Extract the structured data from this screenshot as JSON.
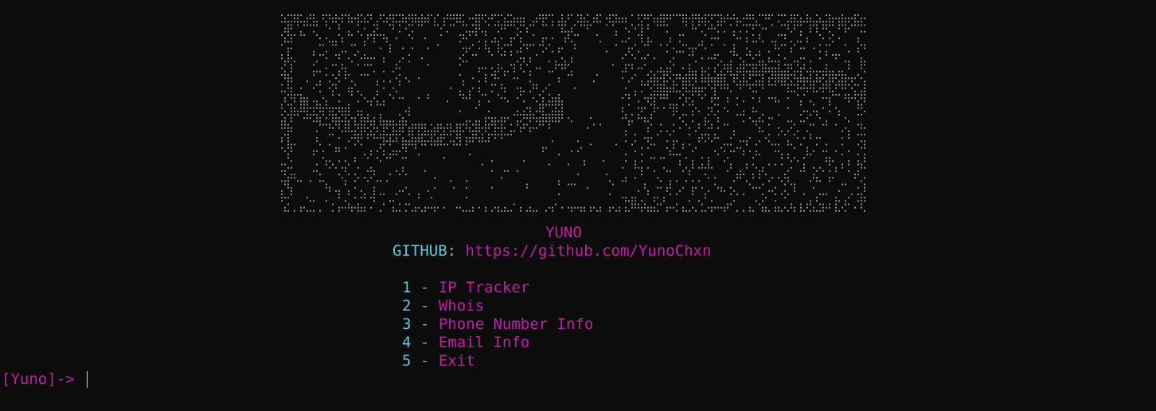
{
  "banner": {
    "name": "ascii-art-banner"
  },
  "title": "YUNO",
  "github": {
    "label": "GITHUB:",
    "url": "https://github.com/YunoChxn"
  },
  "menu": [
    {
      "number": "1",
      "separator": "-",
      "label": "IP Tracker"
    },
    {
      "number": "2",
      "separator": "-",
      "label": "Whois"
    },
    {
      "number": "3",
      "separator": "-",
      "label": "Phone Number Info"
    },
    {
      "number": "4",
      "separator": "-",
      "label": "Email Info"
    },
    {
      "number": "5",
      "separator": "-",
      "label": "Exit"
    }
  ],
  "prompt": "[Yuno]->",
  "colors": {
    "background": "#0c0c0c",
    "magenta": "#c31ca7",
    "cyan": "#5ec8dc",
    "ascii_gray": "#8a8a8a"
  }
}
